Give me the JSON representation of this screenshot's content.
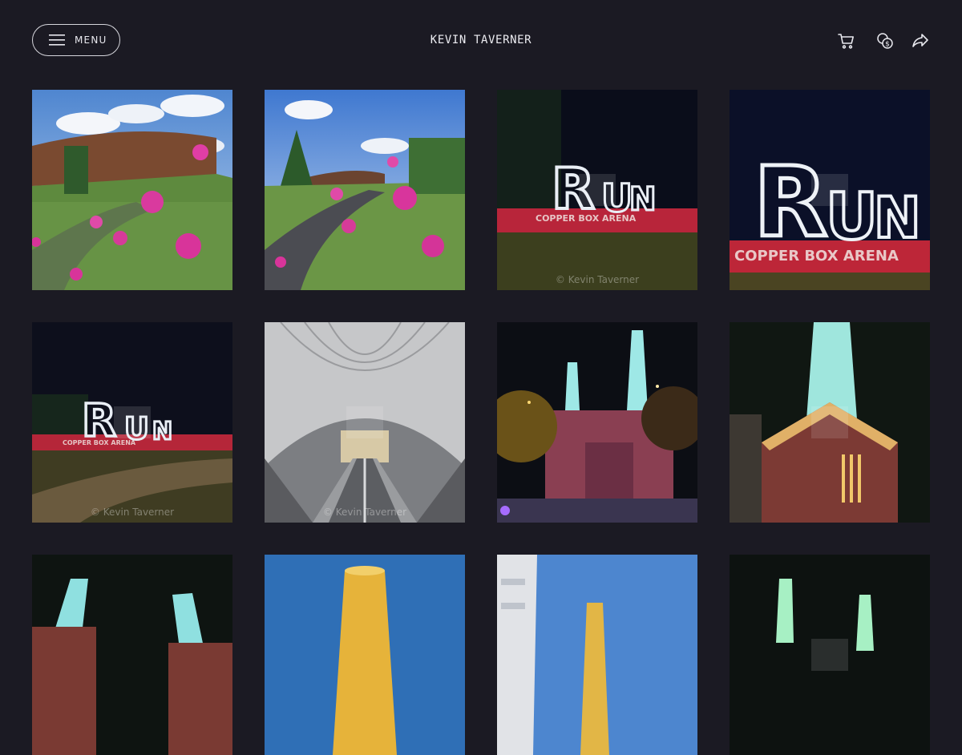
{
  "header": {
    "menu_label": "MENU",
    "site_title": "KEVIN TAVERNER",
    "icons": [
      "menu-icon",
      "cart-icon",
      "currency-icon",
      "share-icon"
    ]
  },
  "gallery": {
    "watermark": "© Kevin Taverner",
    "tiles": [
      {
        "id": "t1",
        "watermark_shown": false
      },
      {
        "id": "t2",
        "watermark_shown": false
      },
      {
        "id": "t3",
        "watermark_shown": true
      },
      {
        "id": "t4",
        "watermark_shown": false
      },
      {
        "id": "t5",
        "watermark_shown": true
      },
      {
        "id": "t6",
        "watermark_shown": true
      },
      {
        "id": "t7",
        "watermark_shown": false
      },
      {
        "id": "t8",
        "watermark_shown": false
      },
      {
        "id": "t9",
        "watermark_shown": false
      },
      {
        "id": "t10",
        "watermark_shown": false
      },
      {
        "id": "t11",
        "watermark_shown": false
      },
      {
        "id": "t12",
        "watermark_shown": false
      }
    ]
  },
  "colors": {
    "background": "#1b1a23",
    "text": "#e8e8ee"
  }
}
